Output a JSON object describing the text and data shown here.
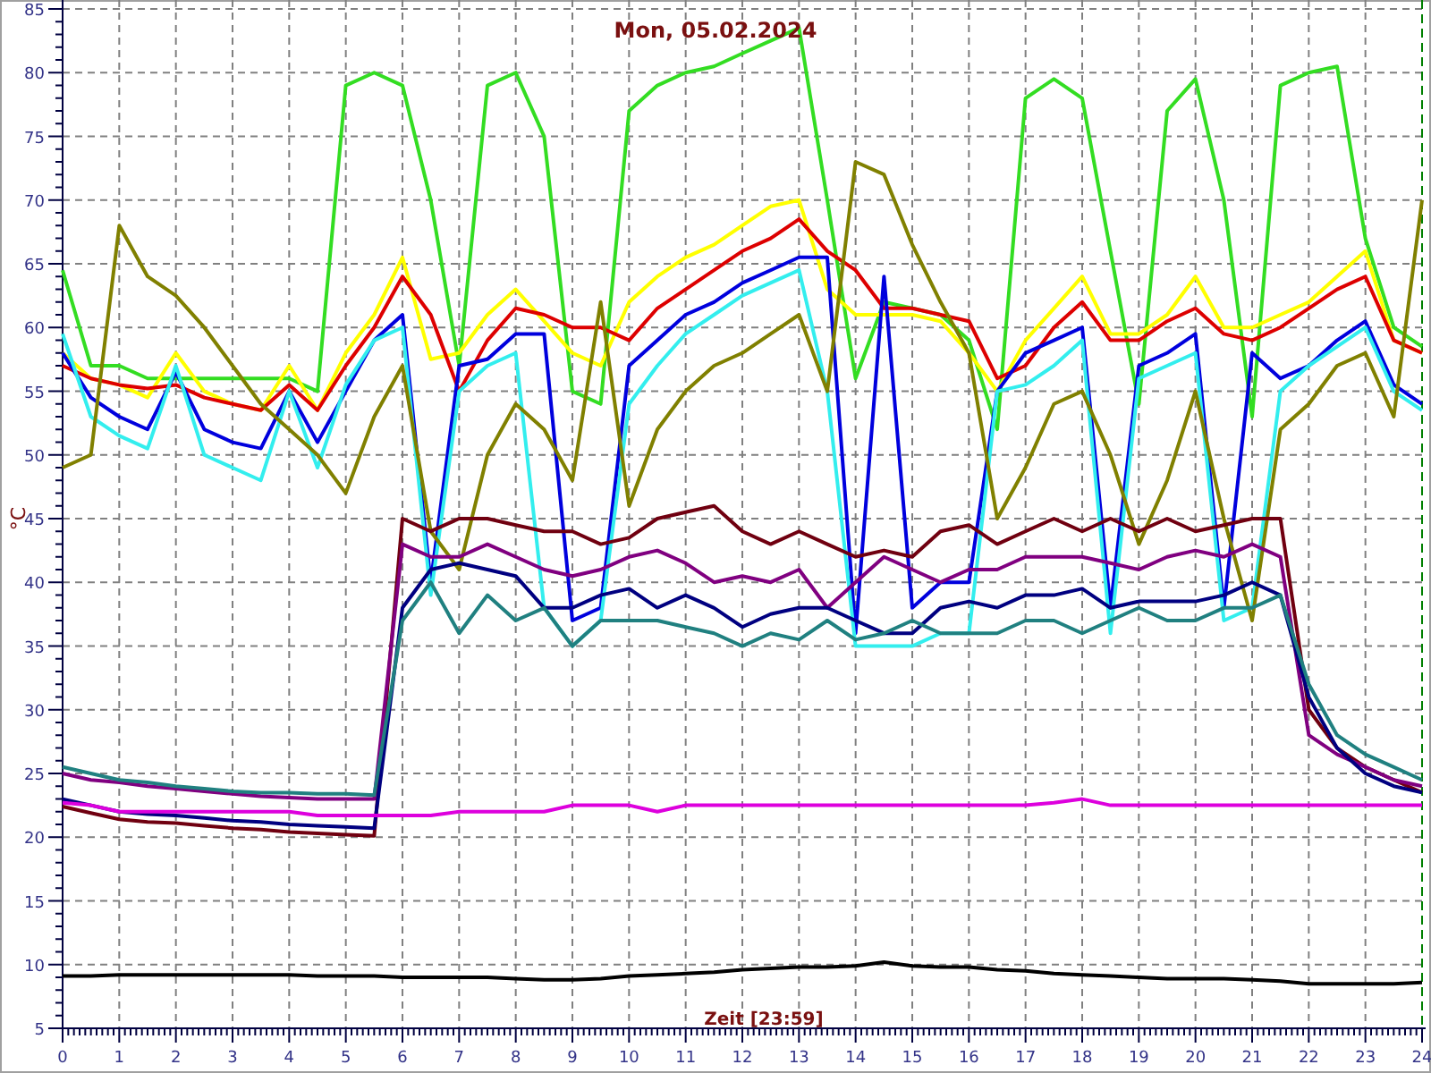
{
  "chart": {
    "chart_data": {
      "type": "line",
      "title": "Mon, 05.02.2024",
      "xlabel": "Zeit [23:59]",
      "ylabel": "°C",
      "x": [
        0,
        0.5,
        1,
        1.5,
        2,
        2.5,
        3,
        3.5,
        4,
        4.5,
        5,
        5.5,
        6,
        6.5,
        7,
        7.5,
        8,
        8.5,
        9,
        9.5,
        10,
        10.5,
        11,
        11.5,
        12,
        12.5,
        13,
        13.5,
        14,
        14.5,
        15,
        15.5,
        16,
        16.5,
        17,
        17.5,
        18,
        18.5,
        19,
        19.5,
        20,
        20.5,
        21,
        21.5,
        22,
        22.5,
        23,
        23.5,
        24
      ],
      "xlim": [
        0,
        24
      ],
      "ylim": [
        5,
        85
      ],
      "xticks": [
        0,
        1,
        2,
        3,
        4,
        5,
        6,
        7,
        8,
        9,
        10,
        11,
        12,
        13,
        14,
        15,
        16,
        17,
        18,
        19,
        20,
        21,
        22,
        23,
        24
      ],
      "yticks": [
        5,
        10,
        15,
        20,
        25,
        30,
        35,
        40,
        45,
        50,
        55,
        60,
        65,
        70,
        75,
        80,
        85
      ],
      "series": [
        {
          "color": "#33dd22",
          "values": [
            64.5,
            57,
            57,
            56,
            56,
            56,
            56,
            56,
            56,
            55,
            79,
            80,
            79,
            70,
            57,
            79,
            80,
            75,
            55,
            54,
            77,
            79,
            80,
            80.5,
            81.5,
            82.5,
            83.5,
            70,
            56,
            62,
            61.5,
            61,
            59,
            52,
            78,
            79.5,
            78,
            66,
            54,
            77,
            79.5,
            70,
            53,
            79,
            80,
            80.5,
            67,
            60,
            58.5
          ]
        },
        {
          "color": "#ffff00",
          "values": [
            58,
            56,
            55.5,
            54.5,
            58,
            55,
            54,
            53.5,
            57,
            53.5,
            58,
            61,
            65.5,
            57.5,
            58,
            61,
            63,
            60.5,
            58,
            57,
            62,
            64,
            65.5,
            66.5,
            68,
            69.5,
            70,
            63,
            61,
            61,
            61,
            60.5,
            58,
            55,
            59,
            61.5,
            64,
            59.5,
            59.5,
            61,
            64,
            60,
            60,
            61,
            62,
            64,
            66,
            59,
            58
          ]
        },
        {
          "color": "#dd0000",
          "values": [
            57,
            56,
            55.5,
            55.2,
            55.5,
            54.5,
            54,
            53.5,
            55.5,
            53.5,
            57,
            60,
            64,
            61,
            55,
            59,
            61.5,
            61,
            60,
            60,
            59,
            61.5,
            63,
            64.5,
            66,
            67,
            68.5,
            66,
            64.5,
            61.5,
            61.5,
            61,
            60.5,
            56,
            57,
            60,
            62,
            59,
            59,
            60.5,
            61.5,
            59.5,
            59,
            60,
            61.5,
            63,
            64,
            59,
            58
          ]
        },
        {
          "color": "#0000dd",
          "values": [
            58,
            54.5,
            53,
            52,
            56.5,
            52,
            51,
            50.5,
            55,
            51,
            55,
            59,
            61,
            40,
            57,
            57.5,
            59.5,
            59.5,
            37,
            38,
            57,
            59,
            61,
            62,
            63.5,
            64.5,
            65.5,
            65.5,
            36,
            64,
            38,
            40,
            40,
            55,
            58,
            59,
            60,
            38,
            57,
            58,
            59.5,
            38,
            58,
            56,
            57,
            59,
            60.5,
            55.5,
            54
          ]
        },
        {
          "color": "#33eeee",
          "values": [
            59.5,
            53,
            51.5,
            50.5,
            57,
            50,
            49,
            48,
            55,
            49,
            55.5,
            59,
            60,
            39,
            55,
            57,
            58,
            38,
            35,
            37,
            54,
            57,
            59.5,
            61,
            62.5,
            63.5,
            64.5,
            55,
            35,
            35,
            35,
            36,
            36,
            55,
            55.5,
            57,
            59,
            36,
            56,
            57,
            58,
            37,
            38,
            55,
            57,
            58.5,
            60,
            55,
            53.5
          ]
        },
        {
          "color": "#808000",
          "values": [
            49,
            50,
            68,
            64,
            62.5,
            60,
            57,
            54,
            52,
            50,
            47,
            53,
            57,
            44,
            41,
            50,
            54,
            52,
            48,
            62,
            46,
            52,
            55,
            57,
            58,
            59.5,
            61,
            55,
            73,
            72,
            66.5,
            62,
            58,
            45,
            49,
            54,
            55,
            50,
            43,
            48,
            55,
            45,
            37,
            52,
            54,
            57,
            58,
            53,
            70
          ]
        },
        {
          "color": "#700010",
          "values": [
            22.4,
            21.9,
            21.4,
            21.2,
            21.1,
            20.9,
            20.7,
            20.6,
            20.4,
            20.3,
            20.2,
            20.1,
            45,
            44,
            45,
            45,
            44.5,
            44,
            44,
            43,
            43.5,
            45,
            45.5,
            46,
            44,
            43,
            44,
            43,
            42,
            42.5,
            42,
            44,
            44.5,
            43,
            44,
            45,
            44,
            45,
            44,
            45,
            44,
            44.5,
            45,
            45,
            30,
            27,
            25.5,
            24.5,
            23.5
          ]
        },
        {
          "color": "#800080",
          "values": [
            25,
            24.5,
            24.3,
            24,
            23.8,
            23.6,
            23.4,
            23.2,
            23.1,
            23,
            23,
            23,
            43,
            42,
            42,
            43,
            42,
            41,
            40.5,
            41,
            42,
            42.5,
            41.5,
            40,
            40.5,
            40,
            41,
            38,
            40,
            42,
            41,
            40,
            41,
            41,
            42,
            42,
            42,
            41.5,
            41,
            42,
            42.5,
            42,
            43,
            42,
            28,
            26.5,
            25.5,
            24.5,
            24
          ]
        },
        {
          "color": "#000080",
          "values": [
            23,
            22.5,
            22,
            21.8,
            21.7,
            21.5,
            21.3,
            21.2,
            21,
            20.9,
            20.8,
            20.7,
            38,
            41,
            41.5,
            41,
            40.5,
            38,
            38,
            39,
            39.5,
            38,
            39,
            38,
            36.5,
            37.5,
            38,
            38,
            37,
            36,
            36,
            38,
            38.5,
            38,
            39,
            39,
            39.5,
            38,
            38.5,
            38.5,
            38.5,
            39,
            40,
            39,
            31,
            27,
            25,
            24,
            23.5
          ]
        },
        {
          "color": "#208080",
          "values": [
            25.5,
            25,
            24.5,
            24.3,
            24,
            23.8,
            23.6,
            23.5,
            23.5,
            23.4,
            23.4,
            23.3,
            37,
            40,
            36,
            39,
            37,
            38,
            35,
            37,
            37,
            37,
            36.5,
            36,
            35,
            36,
            35.5,
            37,
            35.5,
            36,
            37,
            36,
            36,
            36,
            37,
            37,
            36,
            37,
            38,
            37,
            37,
            38,
            38,
            39,
            32,
            28,
            26.5,
            25.5,
            24.5
          ]
        },
        {
          "color": "#dd00dd",
          "values": [
            22.7,
            22.5,
            22,
            22,
            22,
            22,
            22,
            22,
            22,
            21.7,
            21.7,
            21.7,
            21.7,
            21.7,
            22,
            22,
            22,
            22,
            22.5,
            22.5,
            22.5,
            22,
            22.5,
            22.5,
            22.5,
            22.5,
            22.5,
            22.5,
            22.5,
            22.5,
            22.5,
            22.5,
            22.5,
            22.5,
            22.5,
            22.7,
            23,
            22.5,
            22.5,
            22.5,
            22.5,
            22.5,
            22.5,
            22.5,
            22.5,
            22.5,
            22.5,
            22.5,
            22.5
          ]
        },
        {
          "color": "#000000",
          "values": [
            9.1,
            9.1,
            9.2,
            9.2,
            9.2,
            9.2,
            9.2,
            9.2,
            9.2,
            9.1,
            9.1,
            9.1,
            9,
            9,
            9,
            9,
            8.9,
            8.8,
            8.8,
            8.9,
            9.1,
            9.2,
            9.3,
            9.4,
            9.6,
            9.7,
            9.8,
            9.8,
            9.9,
            10.2,
            9.9,
            9.8,
            9.8,
            9.6,
            9.5,
            9.3,
            9.2,
            9.1,
            9,
            8.9,
            8.9,
            8.9,
            8.8,
            8.7,
            8.5,
            8.5,
            8.5,
            8.5,
            8.6
          ]
        }
      ],
      "grid": true
    }
  }
}
